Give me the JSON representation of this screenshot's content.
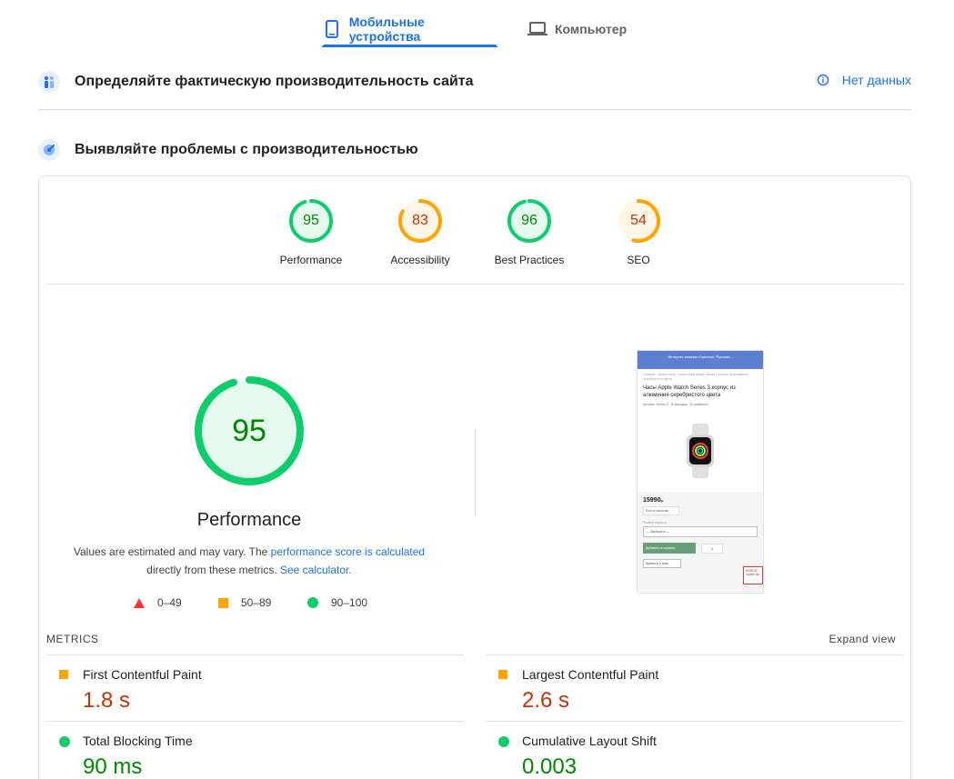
{
  "tabs": {
    "mobile": {
      "label": "Мобильные устройства",
      "icon": "smartphone-icon"
    },
    "desktop": {
      "label": "Компьютер",
      "icon": "laptop-icon"
    }
  },
  "field_section": {
    "title": "Определяйте фактическую производительность сайта",
    "no_data": "Нет данных",
    "icon": "users-icon"
  },
  "lab_section": {
    "title": "Выявляйте проблемы с производительностью",
    "icon": "speed-icon"
  },
  "categories": [
    {
      "name": "Performance",
      "score": "95",
      "value": 95,
      "rating": "pass"
    },
    {
      "name": "Accessibility",
      "score": "83",
      "value": 83,
      "rating": "average"
    },
    {
      "name": "Best Practices",
      "score": "96",
      "value": 96,
      "rating": "pass"
    },
    {
      "name": "SEO",
      "score": "54",
      "value": 54,
      "rating": "average"
    }
  ],
  "main_gauge": {
    "score": "95",
    "value": 95,
    "title": "Performance",
    "desc_prefix": "Values are estimated and may vary. The ",
    "desc_link1": "performance score is calculated",
    "desc_middle": "directly from these metrics. ",
    "desc_link2": "See calculator."
  },
  "legend": [
    {
      "range": "0–49",
      "shape": "triangle",
      "color": "#ff3333"
    },
    {
      "range": "50–89",
      "shape": "square",
      "color": "#ffa400"
    },
    {
      "range": "90–100",
      "shape": "circle",
      "color": "#0cce6b"
    }
  ],
  "thumbnail": {
    "header": "Интернет магазин Opencart \"Русская...",
    "breadcrumbs": "Главная / Умные часы / Часы Apple Watch Series 3 корпус из алюминия серебристого цвета",
    "product_title": "Часы Apple Watch Series 3 корпус из алюминия серебристого цвета",
    "article": "Артикул: Series 3",
    "wishlist": "В закладки",
    "compare": "В сравнение",
    "price": "15990",
    "currency": "р.",
    "stock": "Есть в наличии",
    "option_label": "Размер корпуса",
    "option_select": "--- Выберите ---",
    "add_to_cart": "Добавить в корзину",
    "qty": "1",
    "buy_one_click": "Купить в 1 клик",
    "error_text": "ERROR: invalid da"
  },
  "metrics": {
    "label": "METRICS",
    "expand": "Expand view",
    "items": [
      {
        "title": "First Contentful Paint",
        "value": "1.8 s",
        "rating": "average"
      },
      {
        "title": "Largest Contentful Paint",
        "value": "2.6 s",
        "rating": "average"
      },
      {
        "title": "Total Blocking Time",
        "value": "90 ms",
        "rating": "pass"
      },
      {
        "title": "Cumulative Layout Shift",
        "value": "0.003",
        "rating": "pass"
      }
    ]
  },
  "colors": {
    "accent": "#1a73e8",
    "pass": "#0cce6b",
    "pass_text": "#008800",
    "average": "#ffa400",
    "average_text": "#c33300",
    "fail": "#ff3333"
  }
}
